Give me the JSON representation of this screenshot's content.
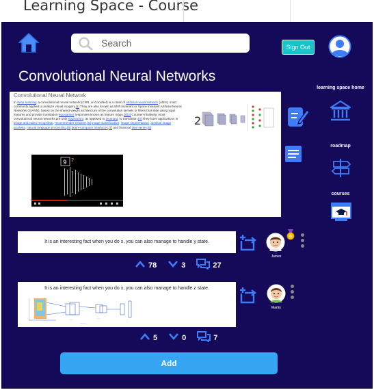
{
  "window": {
    "title": "Learning Space - Course"
  },
  "header": {
    "search_placeholder": "Search",
    "signout_label": "Sign Out"
  },
  "page": {
    "title": "Convolutional Neural Networks"
  },
  "article": {
    "title": "Convolutional Neural Network",
    "body_parts": [
      "In ",
      "deep learning",
      ", a convolutional neural network (CNN, or ConvNet) is a class of ",
      "artificial neural network",
      " (ANN), most commonly applied to analyze visual imagery.",
      "[1]",
      " They are also known as Shift Invariant or Space Invariant Artificial Neural Networks (SIANN), based on the shared-weight architecture of the convolution kernels or filters that slide along input features and provide translation-",
      "equivariant",
      " responses known as feature maps.",
      "[2][3]",
      " Counter-intuitively, most convolutional neural networks are only ",
      "equivariant",
      ", as opposed to ",
      "invariant",
      ", to translation.",
      "[4]",
      " They have applications in ",
      "image and video recognition",
      ", ",
      "recommender systems",
      ",",
      "[5]",
      " ",
      "image classification",
      ", ",
      "image segmentation",
      ", ",
      "medical image analysis",
      ", ",
      "natural language processing",
      ",",
      "[6]",
      " ",
      "brain–computer interfaces",
      ",",
      "[7]",
      " and financial ",
      "time series",
      ".",
      "[8]"
    ],
    "video_digit": "9"
  },
  "sidebar": {
    "home_label": "learning space home",
    "roadmap_label": "roadmap",
    "courses_label": "courses"
  },
  "comments": [
    {
      "text": "It is an interesting fact when you do x, you can also manage to handle y state.",
      "user": "James",
      "upvotes": "78",
      "downvotes": "3",
      "replies": "27"
    },
    {
      "text": "It is an interesting fact when you do x, you can also manage to handle z state.",
      "user": "Martin",
      "upvotes": "5",
      "downvotes": "0",
      "replies": "7"
    }
  ],
  "actions": {
    "add_label": "Add"
  },
  "colors": {
    "background": "#150a5a",
    "accent_blue": "#3f7cf7",
    "signout": "#18c3c9",
    "add_button": "#36a6f3"
  }
}
